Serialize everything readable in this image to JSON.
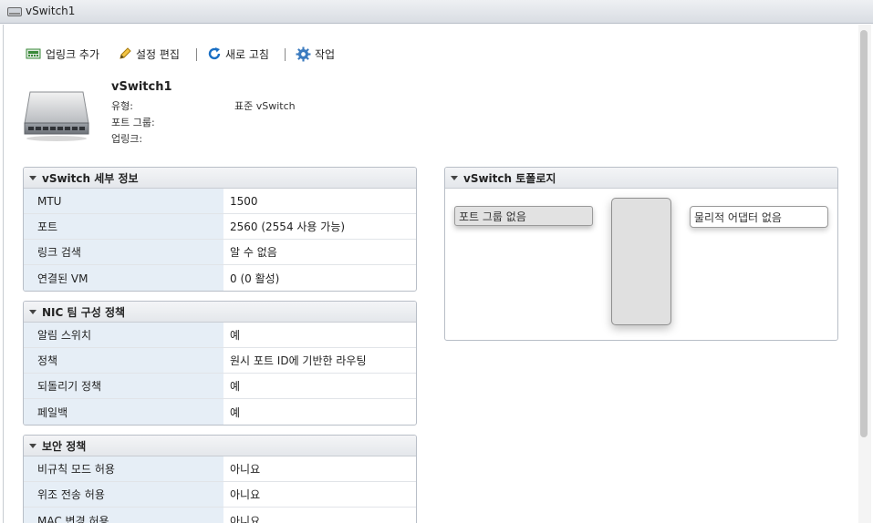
{
  "window": {
    "title": "vSwitch1"
  },
  "toolbar": {
    "add_uplink": "업링크 추가",
    "edit_settings": "설정 편집",
    "refresh": "새로 고침",
    "actions": "작업"
  },
  "summary": {
    "name": "vSwitch1",
    "type_label": "유형:",
    "type_value": "표준 vSwitch",
    "portgroups_label": "포트 그룹:",
    "uplinks_label": "업링크:"
  },
  "details": {
    "title": "vSwitch 세부 정보",
    "rows": [
      {
        "key": "MTU",
        "value": "1500"
      },
      {
        "key": "포트",
        "value": "2560 (2554 사용 가능)"
      },
      {
        "key": "링크 검색",
        "value": "알 수 없음"
      },
      {
        "key": "연결된 VM",
        "value": "0 (0 활성)"
      }
    ]
  },
  "teaming": {
    "title": "NIC 팀 구성 정책",
    "rows": [
      {
        "key": "알림 스위치",
        "value": "예"
      },
      {
        "key": "정책",
        "value": "원시 포트 ID에 기반한 라우팅"
      },
      {
        "key": "되돌리기 정책",
        "value": "예"
      },
      {
        "key": "페일백",
        "value": "예"
      }
    ]
  },
  "security": {
    "title": "보안 정책",
    "rows": [
      {
        "key": "비규칙 모드 허용",
        "value": "아니요"
      },
      {
        "key": "위조 전송 허용",
        "value": "아니요"
      },
      {
        "key": "MAC 변경 허용",
        "value": "아니요"
      }
    ]
  },
  "topology": {
    "title": "vSwitch 토폴로지",
    "no_portgroups": "포트 그룹 없음",
    "no_adapters": "물리적 어댑터 없음"
  },
  "colors": {
    "key_cell_bg": "#e6eef6",
    "refresh_icon": "#1a6fc4",
    "gear_icon": "#3b7bbf",
    "uplink_icon": "#3a8a3a",
    "pencil_icon": "#d8a21c"
  }
}
